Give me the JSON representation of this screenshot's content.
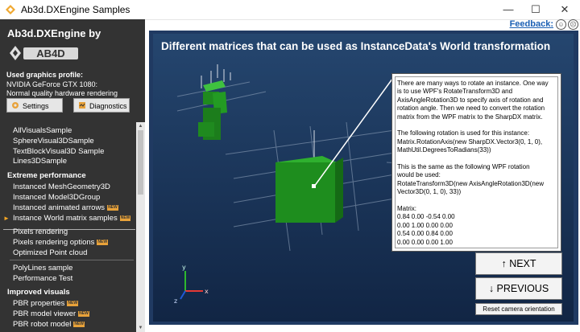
{
  "window": {
    "title": "Ab3d.DXEngine Samples",
    "minimize": "—",
    "maximize": "☐",
    "close": "✕"
  },
  "feedback": {
    "label": "Feedback:",
    "happy_face": "☺",
    "sad_face": "☹"
  },
  "sidebar": {
    "brand": "Ab3d.DXEngine by",
    "logo_text": "AB4D",
    "profile_label": "Used graphics profile:",
    "profile_gpu": "NVIDIA GeForce GTX 1080:",
    "profile_quality": "Normal quality hardware rendering",
    "settings_label": "Settings",
    "diagnostics_label": "Diagnostics",
    "items_top": [
      "AllVisualsSample",
      "SphereVisual3DSample",
      "TextBlockVisual3D Sample",
      "Lines3DSample"
    ],
    "section_extreme": "Extreme performance",
    "items_extreme": [
      "Instanced MeshGeometry3D",
      "Instanced Model3DGroup",
      "Instanced animated arrows",
      "Instance World matrix samples"
    ],
    "items_pixels": [
      "Pixels rendering",
      "Pixels rendering options",
      "Optimized Point cloud"
    ],
    "items_lines": [
      "PolyLines sample",
      "Performance Test"
    ],
    "section_visuals": "Improved visuals",
    "items_visuals": [
      "PBR properties",
      "PBR model viewer",
      "PBR robot model"
    ],
    "new_badge": "NEW"
  },
  "viewport": {
    "title": "Different matrices that can be used as InstanceData's World transformation",
    "info_lines": [
      "There are many ways to rotate an instance. One way",
      "is to use WPF's RotateTransform3D and",
      "AxisAngleRotation3D to specify axis of rotation and",
      "rotation angle. Then we need to convert the rotation",
      "matrix from the WPF matrix to the SharpDX matrix.",
      "",
      "The following rotation is used for this instance:",
      "Matrix.RotationAxis(new SharpDX.Vector3(0, 1, 0),",
      "MathUtil.DegreesToRadians(33))",
      "",
      "This is the same as the following WPF rotation",
      "would be used:",
      "RotateTransform3D(new AxisAngleRotation3D(new",
      "Vector3D(0, 1, 0), 33))",
      "",
      "Matrix:",
      "0.84  0.00  -0.54  0.00",
      "0.00  1.00   0.00  0.00",
      "0.54  0.00   0.84  0.00",
      "0.00  0.00   0.00  1.00"
    ],
    "next_label": "↑ NEXT",
    "previous_label": "↓ PREVIOUS",
    "reset_label": "Reset camera orientation",
    "axis_x": "x",
    "axis_y": "y",
    "axis_z": "z"
  },
  "colors": {
    "sidebar_bg": "#333333",
    "accent_orange": "#f5a623",
    "box_green": "#1f8a1f",
    "viewport_bg": "#1b3558"
  }
}
